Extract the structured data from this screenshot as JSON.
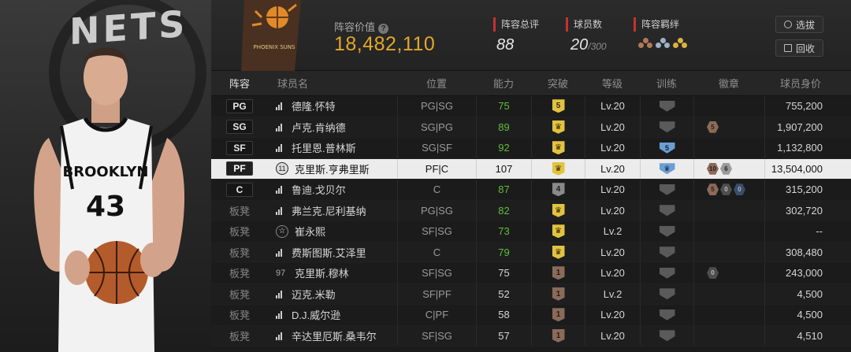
{
  "header": {
    "lineup_value_label": "阵容价值",
    "lineup_value": "18,482,110",
    "overall_label": "阵容总评",
    "overall_value": "88",
    "player_count_label": "球员数",
    "player_count_value": "20",
    "player_count_max": "/300",
    "bond_label": "阵容羁绊",
    "select_button": "选拔",
    "recycle_button": "回收",
    "team_logo_text": "PHOENIX SUNS",
    "player_team_text": "NETS",
    "player_jersey_text": "BROOKLYN",
    "player_jersey_number": "43"
  },
  "table": {
    "headers": {
      "lineup": "阵容",
      "name": "球员名",
      "position": "位置",
      "power": "能力",
      "breakthrough": "突破",
      "level": "等级",
      "training": "训练",
      "badge": "徽章",
      "value": "球员身价"
    },
    "rows": [
      {
        "lineup": "PG",
        "name": "德隆.怀特",
        "position": "PG|SG",
        "power": "75",
        "breakthrough": "5",
        "level": "Lv.20",
        "value": "755,200"
      },
      {
        "lineup": "SG",
        "name": "卢克.肯纳德",
        "position": "SG|PG",
        "power": "89",
        "breakthrough": "",
        "level": "Lv.20",
        "badge": "5",
        "value": "1,907,200"
      },
      {
        "lineup": "SF",
        "name": "托里恩.普林斯",
        "position": "SG|SF",
        "power": "92",
        "breakthrough": "",
        "level": "Lv.20",
        "training": "5",
        "value": "1,132,800"
      },
      {
        "lineup": "PF",
        "name": "克里斯.亨弗里斯",
        "position": "PF|C",
        "power": "107",
        "breakthrough": "",
        "level": "Lv.20",
        "badge1": "10",
        "badge2": "6",
        "number": "11",
        "value": "13,504,000"
      },
      {
        "lineup": "C",
        "name": "鲁迪.戈贝尔",
        "position": "C",
        "power": "87",
        "breakthrough": "4",
        "level": "Lv.20",
        "badge1": "5",
        "badge2": "0",
        "badge3": "0",
        "value": "315,200"
      },
      {
        "lineup": "板凳",
        "name": "弗兰克.尼利基纳",
        "position": "PG|SG",
        "power": "82",
        "breakthrough": "",
        "level": "Lv.20",
        "value": "302,720"
      },
      {
        "lineup": "板凳",
        "name": "崔永熙",
        "position": "SF|SG",
        "power": "73",
        "breakthrough": "",
        "level": "Lv.2",
        "value": "--"
      },
      {
        "lineup": "板凳",
        "name": "费斯图斯.艾泽里",
        "position": "C",
        "power": "79",
        "breakthrough": "",
        "level": "Lv.20",
        "value": "308,480"
      },
      {
        "lineup": "板凳",
        "name": "克里斯.穆林",
        "position": "SF|SG",
        "power": "75",
        "breakthrough": "1",
        "level": "Lv.20",
        "badge1": "0",
        "number": "97",
        "value": "243,000"
      },
      {
        "lineup": "板凳",
        "name": "迈克.米勒",
        "position": "SF|PF",
        "power": "52",
        "breakthrough": "1",
        "level": "Lv.2",
        "value": "4,500"
      },
      {
        "lineup": "板凳",
        "name": "D.J.威尔逊",
        "position": "C|PF",
        "power": "58",
        "breakthrough": "1",
        "level": "Lv.20",
        "value": "4,500"
      },
      {
        "lineup": "板凳",
        "name": "辛达里厄斯.桑韦尔",
        "position": "SF|SG",
        "power": "57",
        "breakthrough": "1",
        "level": "Lv.20",
        "value": "4,510"
      }
    ]
  },
  "colors": {
    "accent_gold": "#e4a62b",
    "label_red": "#c63131",
    "power_green": "#5fbf3b",
    "selected_row": "#ececec"
  }
}
